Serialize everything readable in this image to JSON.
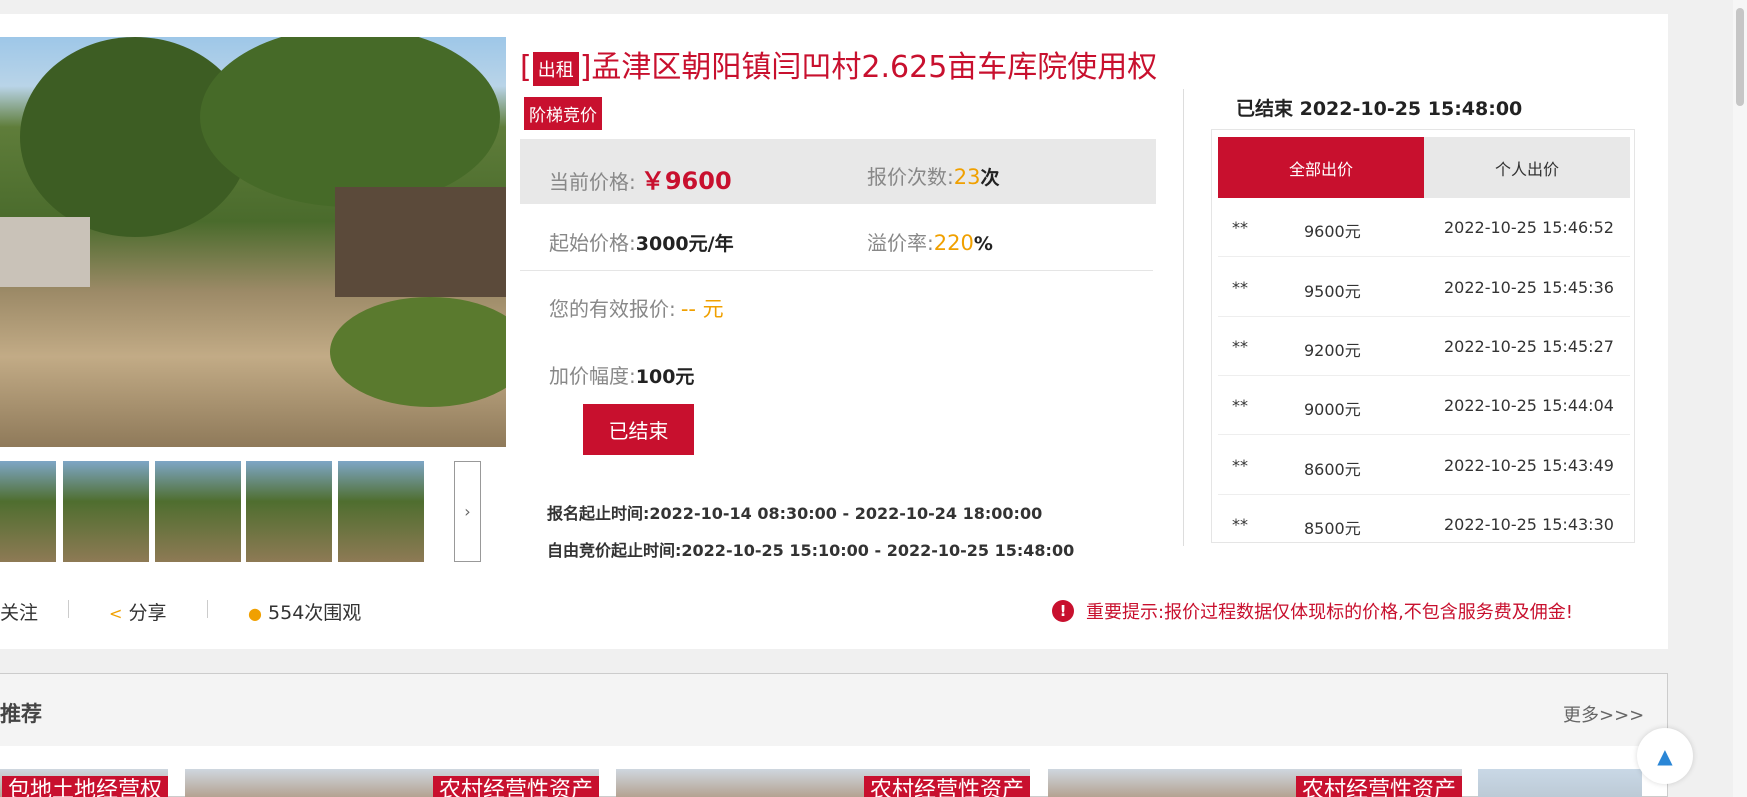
{
  "listing": {
    "title_prefix": "[",
    "title_tag": "出租",
    "title_suffix": "]孟津区朝阳镇闫凹村2.625亩车库院使用权",
    "auction_type": "阶梯竞价",
    "current_price_label": "当前价格:",
    "current_price": "￥9600",
    "bid_count_label": "报价次数:",
    "bid_count": "23",
    "bid_count_unit": "次",
    "start_price_label": "起始价格:",
    "start_price": "3000元/年",
    "premium_label": "溢价率:",
    "premium_value": "220",
    "premium_unit": "%",
    "my_bid_label": "您的有效报价:",
    "my_bid_value": "-- 元",
    "increment_label": "加价幅度:",
    "increment_value": "100元",
    "status_button": "已结束",
    "signup_label": "报名起止时间:",
    "signup_range": "2022-10-14 08:30:00 - 2022-10-24 18:00:00",
    "bidding_label": "自由竞价起止时间:",
    "bidding_range": "2022-10-25 15:10:00 - 2022-10-25 15:48:00"
  },
  "bids_panel": {
    "ended_status": "已结束 2022-10-25 15:48:00",
    "tab_all": "全部出价",
    "tab_mine": "个人出价",
    "rows": [
      {
        "bidder": "**",
        "amount": "9600元",
        "time": "2022-10-25 15:46:52"
      },
      {
        "bidder": "**",
        "amount": "9500元",
        "time": "2022-10-25 15:45:36"
      },
      {
        "bidder": "**",
        "amount": "9200元",
        "time": "2022-10-25 15:45:27"
      },
      {
        "bidder": "**",
        "amount": "9000元",
        "time": "2022-10-25 15:44:04"
      },
      {
        "bidder": "**",
        "amount": "8600元",
        "time": "2022-10-25 15:43:49"
      },
      {
        "bidder": "**",
        "amount": "8500元",
        "time": "2022-10-25 15:43:30"
      }
    ]
  },
  "actions": {
    "follow": "关注",
    "share": "分享",
    "views": "554次围观"
  },
  "notice": "重要提示:报价过程数据仅体现标的价格,不包含服务费及佣金!",
  "recommend": {
    "title": "推荐",
    "more": "更多>>>",
    "cards": [
      {
        "tag": "包地土地经营权"
      },
      {
        "tag": "农村经营性资产"
      },
      {
        "tag": "农村经营性资产"
      },
      {
        "tag": "农村经营性资产"
      }
    ]
  },
  "icons": {
    "next": "chevron-right-icon",
    "share": "share-icon",
    "views": "user-icon",
    "notice": "alert-icon",
    "top": "arrow-up-icon"
  },
  "colors": {
    "accent": "#c8102e",
    "highlight": "#f0a000"
  }
}
